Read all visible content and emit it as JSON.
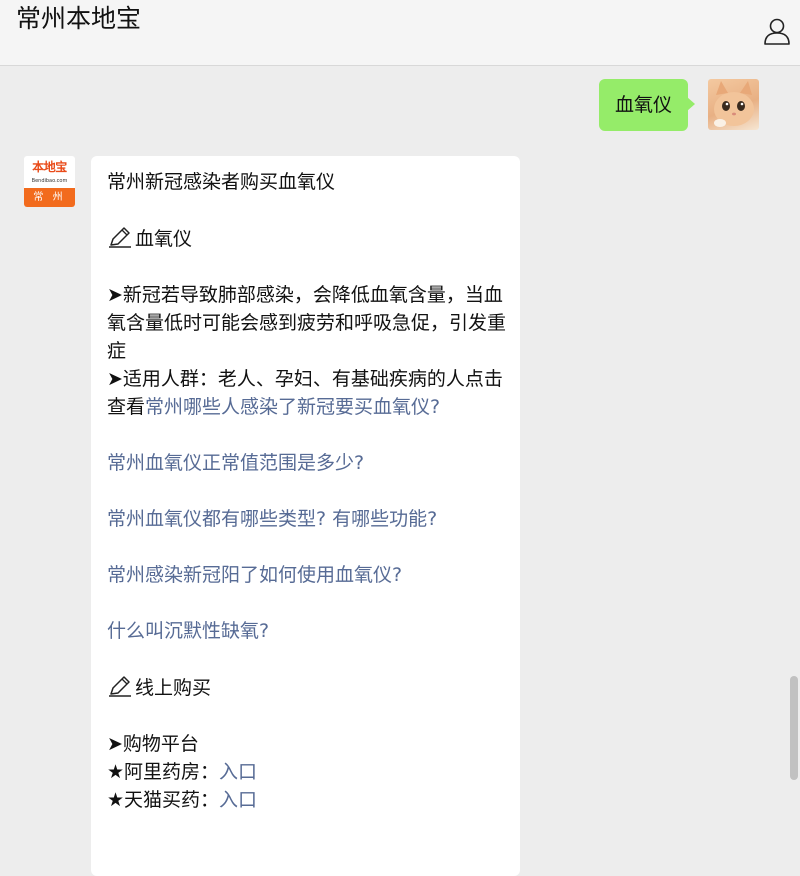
{
  "header": {
    "title": "常州本地宝"
  },
  "outgoing": {
    "text": "血氧仪"
  },
  "bot_avatar": {
    "brand": "本地宝",
    "site": "Bendibao.com",
    "city": "常 州"
  },
  "message": {
    "title": "常州新冠感染者购买血氧仪",
    "section1_heading": "血氧仪",
    "para1": "➤新冠若导致肺部感染，会降低血氧含量，当血氧含量低时可能会感到疲劳和呼吸急促，引发重症",
    "para2_prefix": "➤适用人群：老人、孕妇、有基础疾病的人点击查看",
    "para2_link": "常州哪些人感染了新冠要买血氧仪?",
    "links": [
      "常州血氧仪正常值范围是多少?",
      "常州血氧仪都有哪些类型? 有哪些功能?",
      "常州感染新冠阳了如何使用血氧仪?",
      "什么叫沉默性缺氧?"
    ],
    "section2_heading": "线上购买",
    "platform_heading": "➤购物平台",
    "platforms": [
      {
        "name": "★阿里药房：",
        "link": "入口"
      },
      {
        "name": "★天猫买药：",
        "link": "入口"
      }
    ]
  },
  "colors": {
    "link": "#576b95",
    "outgoing_bubble": "#95ec69",
    "background": "#ededed"
  },
  "icons": [
    "user-icon",
    "pencil-icon"
  ]
}
